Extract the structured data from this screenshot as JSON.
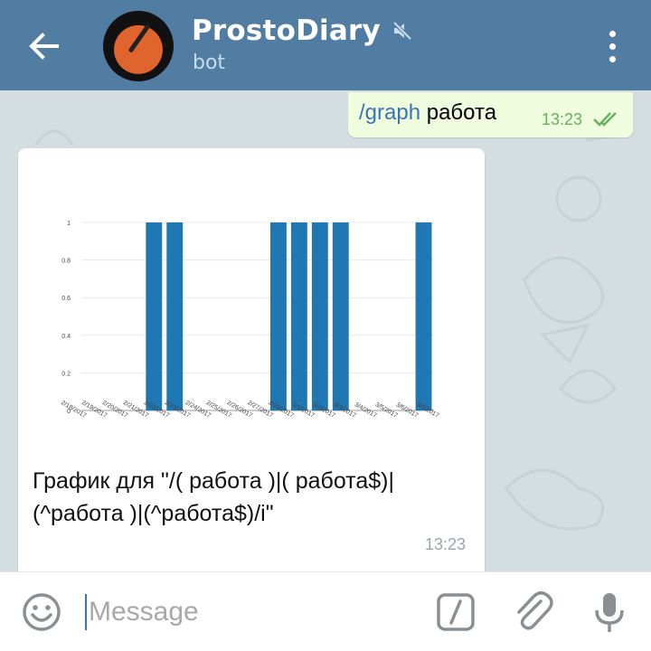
{
  "header": {
    "title": "ProstoDiary",
    "subtitle": "bot",
    "icons": [
      "back-arrow-icon",
      "muted-icon",
      "more-vertical-icon"
    ]
  },
  "outgoing": {
    "command": "/graph",
    "text": "работа",
    "time": "13:23",
    "status_icon": "double-check-icon"
  },
  "incoming": {
    "caption": "График для \"/( работа )|( работа$)|(^работа )|(^работа$)/i\"",
    "time": "13:23"
  },
  "chart_data": {
    "type": "bar",
    "categories": [
      "2/18/2017",
      "2/19/2017",
      "2/20/2017",
      "2/21/2017",
      "2/22/2017",
      "2/23/2017",
      "2/24/2017",
      "2/25/2017",
      "2/26/2017",
      "2/27/2017",
      "2/28/2017",
      "3/1/2017",
      "3/2/2017",
      "3/3/2017",
      "3/4/2017",
      "3/5/2017",
      "3/6/2017",
      "3/8/2017"
    ],
    "values": [
      0,
      0,
      0,
      1,
      1,
      0,
      0,
      0,
      0,
      1,
      1,
      1,
      1,
      0,
      0,
      0,
      1,
      0
    ],
    "yticks": [
      "0",
      "0.2",
      "0.4",
      "0.6",
      "0.8",
      "1"
    ],
    "ylim": [
      0,
      1
    ],
    "bar_color": "#1f77b4",
    "grid": true
  },
  "composer": {
    "placeholder": "Message",
    "icons": [
      "emoji-icon",
      "command-icon",
      "attach-icon",
      "mic-icon"
    ]
  },
  "colors": {
    "header_bg": "#527da3",
    "outgoing_bubble": "#effdde",
    "accent": "#3b74b5"
  }
}
